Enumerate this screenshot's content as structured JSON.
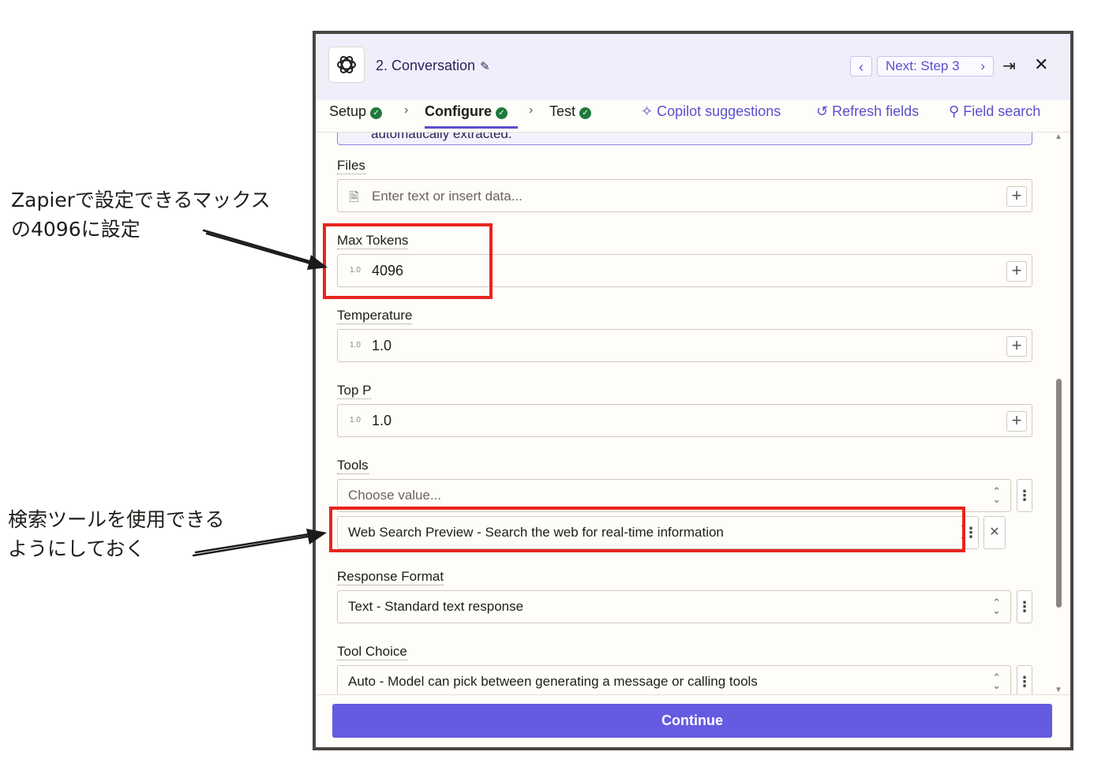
{
  "annotations": {
    "note1_line1": "Zapierで設定できるマックス",
    "note1_line2": "の4096に設定",
    "note2_line1": "検索ツールを使用できる",
    "note2_line2": "ようにしておく"
  },
  "header": {
    "logo_icon": "openai-logo-icon",
    "title": "2. Conversation",
    "prev_icon": "chevron-left-icon",
    "next_label": "Next: Step 3",
    "expand_icon": "expand-right-icon",
    "close_icon": "close-icon"
  },
  "tabs": {
    "setup": "Setup",
    "configure": "Configure",
    "test": "Test",
    "copilot": "Copilot suggestions",
    "refresh": "Refresh fields",
    "search": "Field search"
  },
  "info_box": {
    "text": "automatically extracted."
  },
  "fields": {
    "files": {
      "label": "Files",
      "placeholder": "Enter text or insert data..."
    },
    "max_tokens": {
      "label": "Max Tokens",
      "value": "4096"
    },
    "temperature": {
      "label": "Temperature",
      "value": "1.0"
    },
    "top_p": {
      "label": "Top P",
      "value": "1.0"
    },
    "tools": {
      "label": "Tools",
      "placeholder": "Choose value...",
      "selected": "Web Search Preview - Search the web for real-time information"
    },
    "response_format": {
      "label": "Response Format",
      "value": "Text - Standard text response"
    },
    "tool_choice": {
      "label": "Tool Choice",
      "value": "Auto - Model can pick between generating a message or calling tools"
    }
  },
  "number_badge": "1.0",
  "footer": {
    "continue_label": "Continue"
  },
  "colors": {
    "accent": "#655be0",
    "highlight": "#e8241e",
    "header_bg": "#f0eefb"
  }
}
